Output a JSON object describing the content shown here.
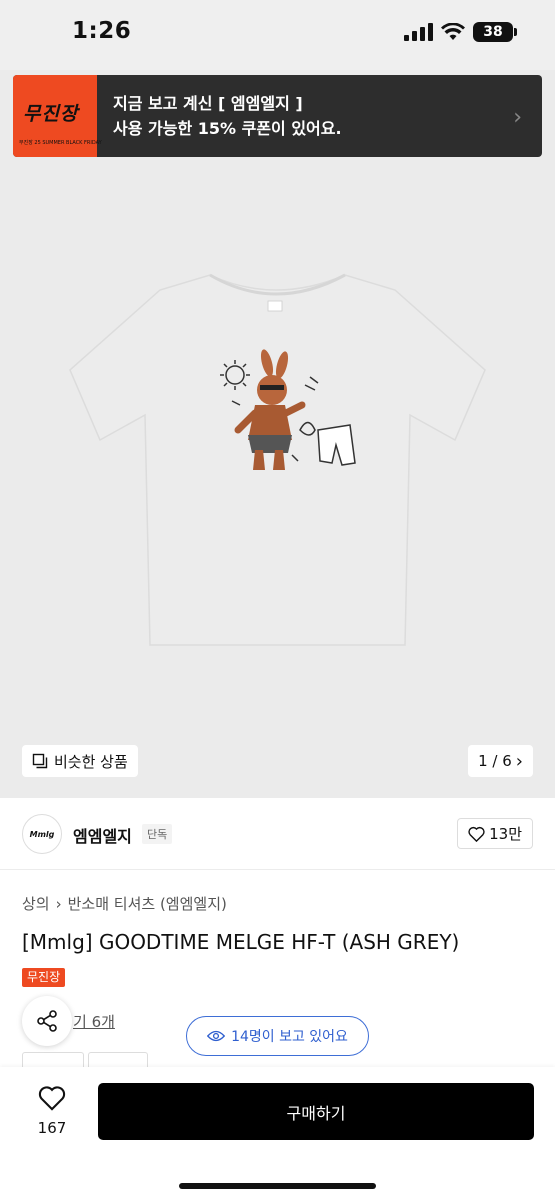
{
  "status_bar": {
    "time": "1:26",
    "battery": "38"
  },
  "promo": {
    "logo_text": "무진장",
    "logo_small": "무진장 25 SUMMER BLACK FRIDAY",
    "line1": "지금 보고 계신 [ 엠엠엘지 ]",
    "line2": "사용 가능한 15% 쿠폰이 있어요."
  },
  "gallery": {
    "similar_label": "비슷한 상품",
    "pager": "1 / 6",
    "colors": {
      "background": "#ebebeb",
      "shirt": "#ececec"
    }
  },
  "brand": {
    "logo_text": "Mmlg",
    "name": "엠엠엘지",
    "tag": "단독",
    "likes": "13만"
  },
  "product": {
    "breadcrumb": [
      "상의",
      "반소매 티셔츠 (엠엠엘지)"
    ],
    "title": "[Mmlg] GOODTIME MELGE HF-T (ASH GREY)",
    "badge": "무진장",
    "review_link": "기 6개",
    "viewers": "14명이 보고 있어요"
  },
  "bottom_bar": {
    "wish_count": "167",
    "buy_label": "구매하기"
  },
  "colors": {
    "accent": "#ee4a21",
    "viewer_blue": "#3e6ed6",
    "buy_button": "#000000"
  }
}
